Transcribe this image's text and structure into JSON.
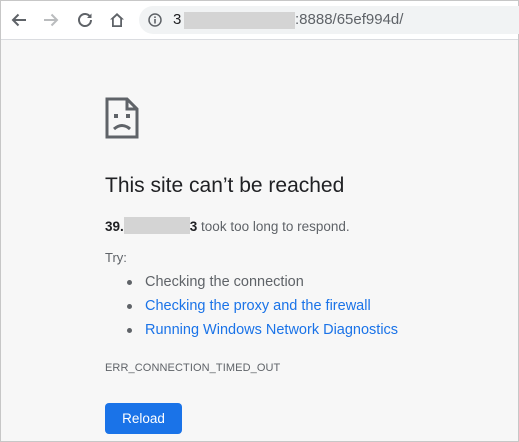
{
  "browser": {
    "url_prefix": "3",
    "url_suffix": ":8888/65ef994d/",
    "icons": [
      "back-arrow-icon",
      "forward-arrow-icon",
      "reload-icon",
      "home-icon",
      "info-icon"
    ]
  },
  "error": {
    "icon": "sad-page-icon",
    "heading": "This site can’t be reached",
    "host_prefix": "39.",
    "host_suffix": "3",
    "detail": " took too long to respond.",
    "try_label": "Try:",
    "suggestions": [
      {
        "text": "Checking the connection",
        "link": false
      },
      {
        "text": "Checking the proxy and the firewall",
        "link": true
      },
      {
        "text": "Running Windows Network Diagnostics",
        "link": true
      }
    ],
    "code": "ERR_CONNECTION_TIMED_OUT",
    "reload_label": "Reload"
  },
  "colors": {
    "link": "#1a73e8",
    "button": "#1a73e8",
    "page_background": "#f7f7f7",
    "redaction": "#d4d4d4"
  }
}
